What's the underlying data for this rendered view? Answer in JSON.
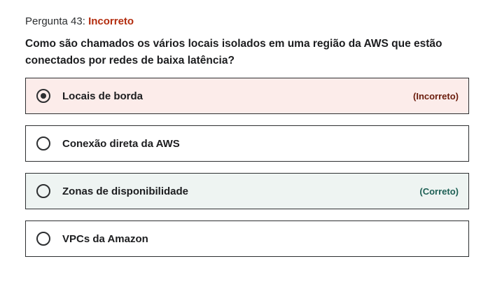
{
  "question": {
    "number_label": "Pergunta 43:",
    "status": "Incorreto",
    "text": "Como são chamados os vários locais isolados em uma região da AWS que estão conectados por redes de baixa latência?"
  },
  "options": [
    {
      "label": "Locais de borda",
      "tag": "(Incorreto)",
      "selected": true,
      "state": "incorrect"
    },
    {
      "label": "Conexão direta da AWS",
      "tag": "",
      "selected": false,
      "state": "neutral"
    },
    {
      "label": "Zonas de disponibilidade",
      "tag": "(Correto)",
      "selected": false,
      "state": "correct"
    },
    {
      "label": "VPCs da Amazon",
      "tag": "",
      "selected": false,
      "state": "neutral"
    }
  ],
  "colors": {
    "incorrect_status": "#b32d0f",
    "incorrect_background": "#fcecea",
    "correct_background": "#eef4f2",
    "correct_tag": "#1e6055",
    "incorrect_tag": "#6a1b0b",
    "border": "#2d2f31"
  }
}
